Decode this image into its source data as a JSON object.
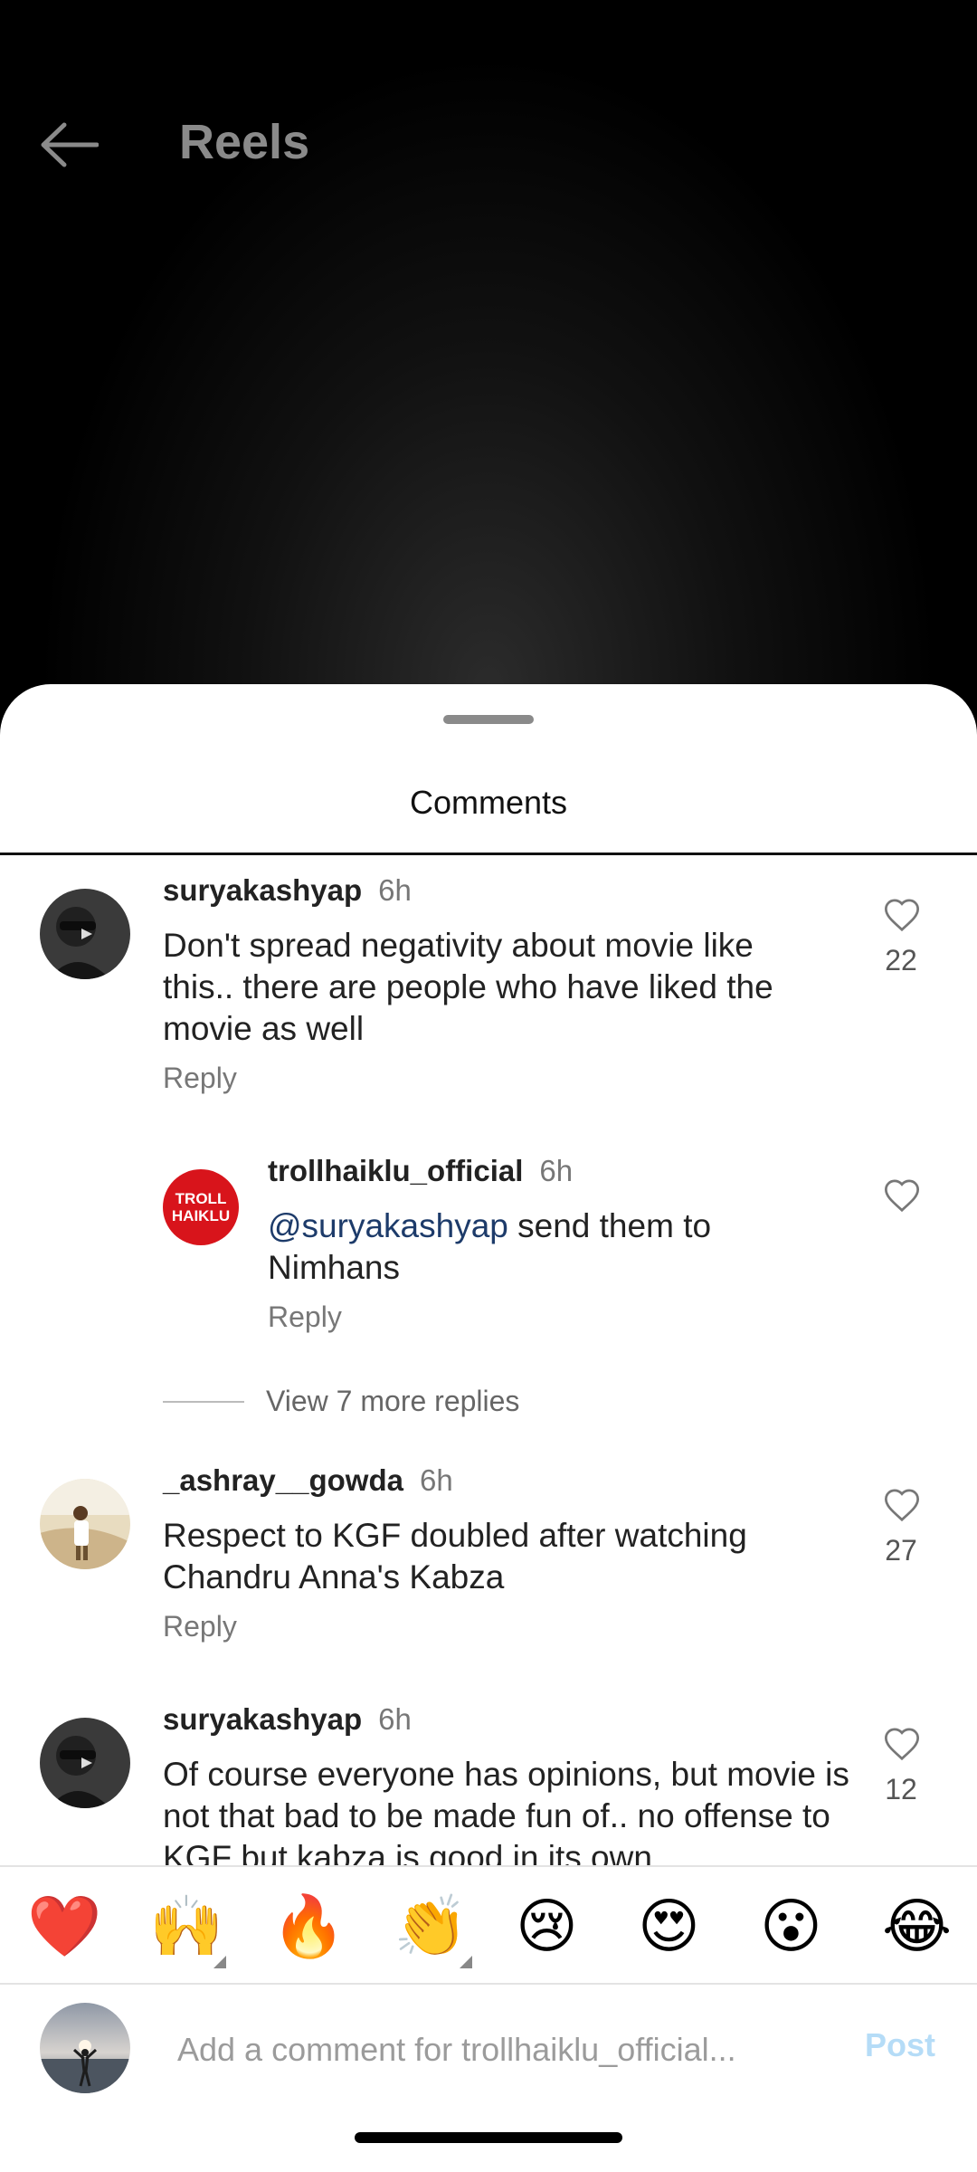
{
  "header": {
    "title": "Reels"
  },
  "sheet": {
    "title": "Comments"
  },
  "comments": [
    {
      "username": "suryakashyap",
      "time": "6h",
      "text": "Don't spread negativity about movie like this.. there are people who have liked the movie as well",
      "reply_label": "Reply",
      "likes": "22"
    },
    {
      "username": "trollhaiklu_official",
      "time": "6h",
      "mention": "@suryakashyap",
      "text": " send them to Nimhans",
      "reply_label": "Reply",
      "avatar_text_1": "TROLL",
      "avatar_text_2": "HAIKLU"
    },
    {
      "username": "_ashray__gowda",
      "time": "6h",
      "text": "Respect to KGF doubled after watching Chandru Anna's Kabza",
      "reply_label": "Reply",
      "likes": "27"
    },
    {
      "username": "suryakashyap",
      "time": "6h",
      "text": "Of course everyone has opinions, but movie is not that bad to be made fun of.. no offense to KGF but kabza is good in its own",
      "likes": "12"
    }
  ],
  "view_more": {
    "label": "View 7 more replies"
  },
  "emoji_bar": [
    "❤️",
    "🙌",
    "🔥",
    "👏",
    "😢",
    "😍",
    "😮",
    "😂"
  ],
  "input": {
    "placeholder": "Add a comment for trollhaiklu_official...",
    "post_label": "Post"
  },
  "colors": {
    "mention": "#1d3b6a",
    "post_disabled": "#b5dcf7",
    "troll_logo_red": "#d8141b"
  }
}
